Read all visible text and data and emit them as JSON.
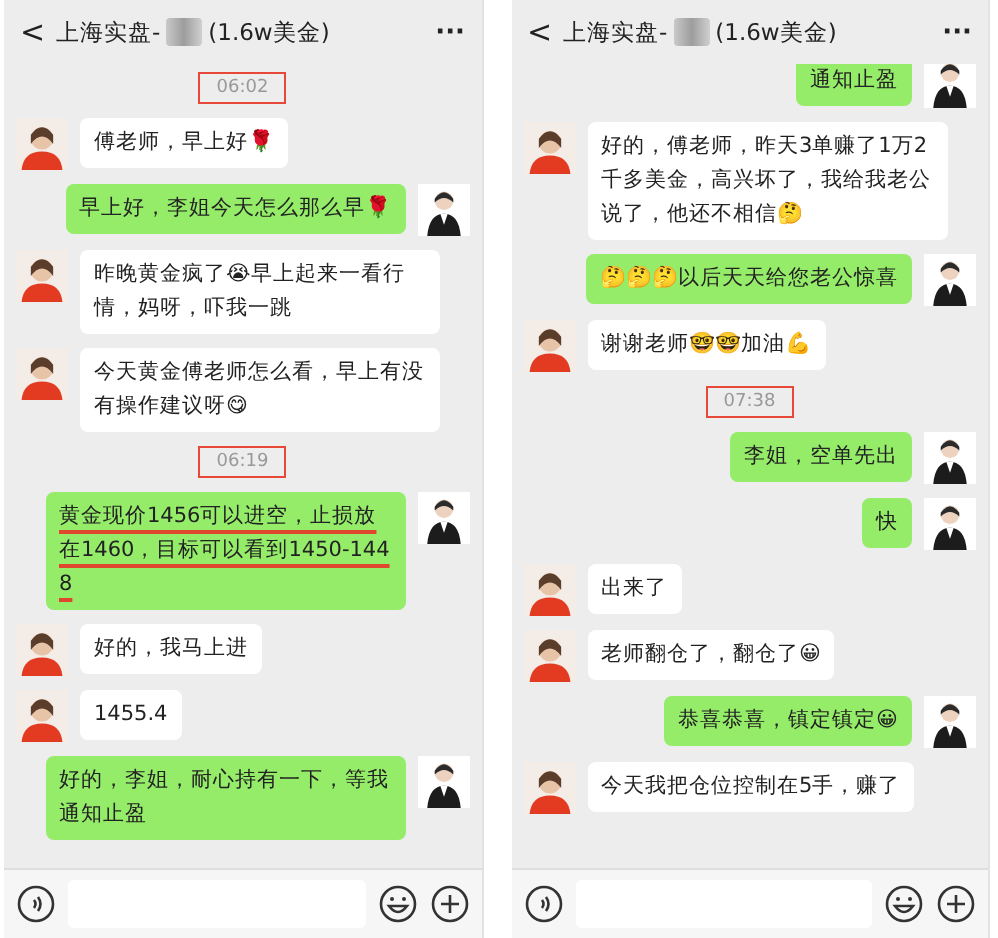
{
  "panels": [
    {
      "header": {
        "back": "<",
        "title": "上海实盘-",
        "note": "(1.6w美金)",
        "more": "···"
      },
      "messages": [
        {
          "kind": "time",
          "text": "06:02",
          "highlighted": true
        },
        {
          "kind": "in",
          "text": "傅老师，早上好🌹",
          "underlined": false,
          "partial": false
        },
        {
          "kind": "out",
          "text": "早上好，李姐今天怎么那么早🌹",
          "underlined": false,
          "partial": false
        },
        {
          "kind": "in",
          "text": "昨晚黄金疯了😭早上起来一看行情，妈呀，吓我一跳",
          "underlined": false,
          "partial": false
        },
        {
          "kind": "in",
          "text": "今天黄金傅老师怎么看，早上有没有操作建议呀😋",
          "underlined": false,
          "partial": false
        },
        {
          "kind": "time",
          "text": "06:19",
          "highlighted": true
        },
        {
          "kind": "out",
          "text": "黄金现价1456可以进空，止损放在1460，目标可以看到1450-1448",
          "underlined": true,
          "partial": false
        },
        {
          "kind": "in",
          "text": "好的，我马上进",
          "underlined": false,
          "partial": false
        },
        {
          "kind": "in",
          "text": "1455.4",
          "underlined": false,
          "partial": false
        },
        {
          "kind": "out",
          "text": "好的，李姐，耐心持有一下，等我通知止盈",
          "underlined": false,
          "partial": false
        }
      ]
    },
    {
      "header": {
        "back": "<",
        "title": "上海实盘-",
        "note": "(1.6w美金)",
        "more": "···"
      },
      "messages": [
        {
          "kind": "out",
          "text": "通知止盈",
          "underlined": false,
          "partial": true
        },
        {
          "kind": "in",
          "text": "好的，傅老师，昨天3单赚了1万2千多美金，高兴坏了，我给我老公说了，他还不相信🤔",
          "underlined": false,
          "partial": false
        },
        {
          "kind": "out",
          "text": "🤔🤔🤔以后天天给您老公惊喜",
          "underlined": false,
          "partial": false
        },
        {
          "kind": "in",
          "text": "谢谢老师🤓🤓加油💪",
          "underlined": false,
          "partial": false
        },
        {
          "kind": "time",
          "text": "07:38",
          "highlighted": true
        },
        {
          "kind": "out",
          "text": "李姐，空单先出",
          "underlined": false,
          "partial": false
        },
        {
          "kind": "out",
          "text": "快",
          "underlined": false,
          "partial": false
        },
        {
          "kind": "in",
          "text": "出来了",
          "underlined": false,
          "partial": false
        },
        {
          "kind": "in",
          "text": "老师翻仓了，翻仓了😀",
          "underlined": false,
          "partial": false
        },
        {
          "kind": "out",
          "text": "恭喜恭喜，镇定镇定😀",
          "underlined": false,
          "partial": false
        },
        {
          "kind": "in",
          "text": "今天我把仓位控制在5手，赚了",
          "underlined": false,
          "partial": false
        }
      ]
    }
  ]
}
